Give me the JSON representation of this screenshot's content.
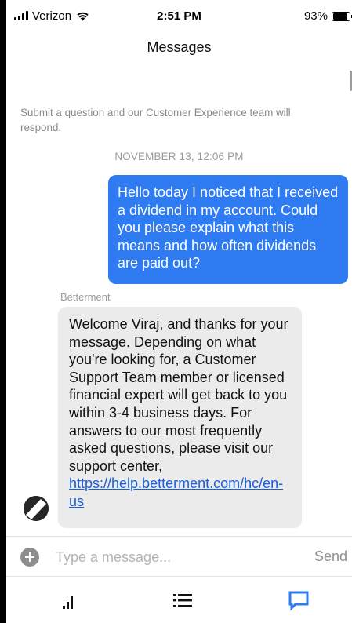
{
  "status_bar": {
    "carrier": "Verizon",
    "time": "2:51 PM",
    "battery_percent": "93%",
    "battery_level": 0.93
  },
  "header": {
    "title": "Messages"
  },
  "conversation": {
    "intro": "Submit a question and our Customer Experience team will respond.",
    "date_label": "NOVEMBER 13, 12:06 PM",
    "outgoing_message": "Hello today I noticed that I received a dividend in my account. Could you please explain what this means and how often dividends are paid out?",
    "reply_sender": "Betterment",
    "reply_text": "Welcome Viraj, and thanks for your message. Depending on what you're looking for, a Customer Support Team member or licensed financial expert will get back to you within 3-4 business days. For answers to our most frequently asked questions, please visit our support center,",
    "reply_link_text": "https://help.betterment.com/hc/en-us"
  },
  "composer": {
    "placeholder": "Type a message...",
    "value": "",
    "send_label": "Send"
  },
  "tab_bar": {
    "active_tab": "messages",
    "accent_color": "#2f7bf1",
    "inactive_color": "#111111",
    "tabs": [
      {
        "id": "performance",
        "icon": "bar-chart-icon"
      },
      {
        "id": "activity",
        "icon": "list-icon"
      },
      {
        "id": "messages",
        "icon": "chat-bubble-icon"
      }
    ]
  },
  "colors": {
    "outgoing_bubble": "#2f7bf1",
    "incoming_bubble": "#ebebeb",
    "link": "#1a5fd6"
  }
}
